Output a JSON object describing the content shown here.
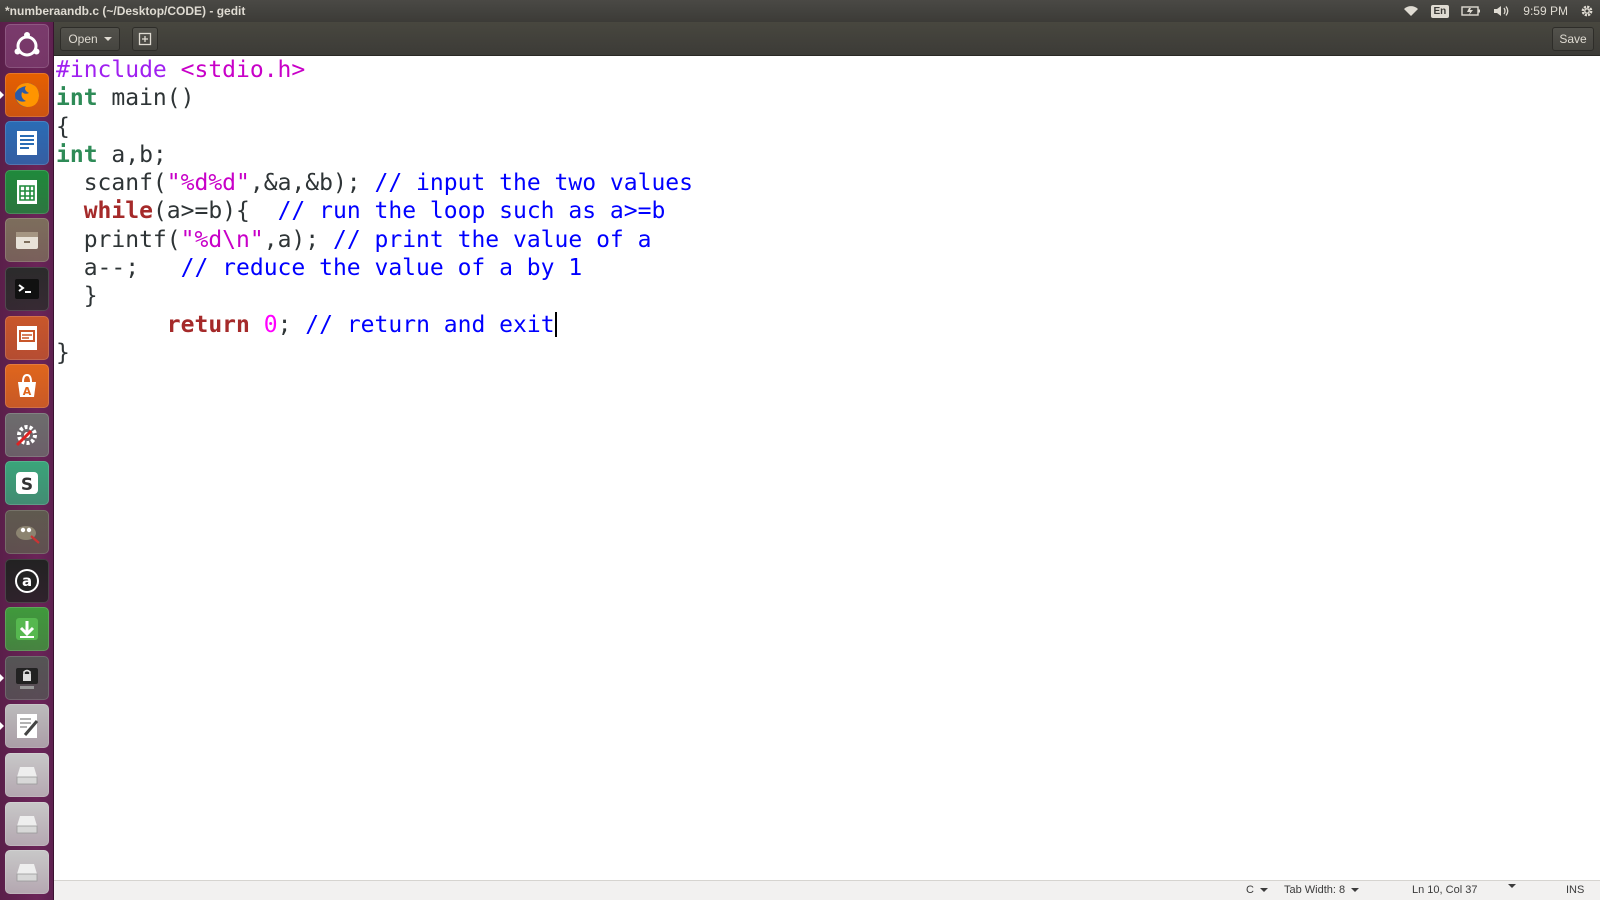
{
  "window": {
    "title": "*numberaandb.c (~/Desktop/CODE) - gedit"
  },
  "panel": {
    "keyboard_layout": "En",
    "clock": "9:59 PM",
    "icons": [
      "wifi-icon",
      "battery-icon",
      "volume-icon",
      "gear-icon"
    ]
  },
  "launcher": {
    "items": [
      {
        "name": "ubuntu-dash-icon",
        "color": "#7a3b6c"
      },
      {
        "name": "firefox-icon",
        "color": "#e66000"
      },
      {
        "name": "libreoffice-writer-icon",
        "color": "#2a6cb5"
      },
      {
        "name": "libreoffice-calc-icon",
        "color": "#1f8a3b"
      },
      {
        "name": "files-icon",
        "color": "#7d6e5c"
      },
      {
        "name": "terminal-icon",
        "color": "#2b2b2b"
      },
      {
        "name": "libreoffice-impress-icon",
        "color": "#c9572a"
      },
      {
        "name": "software-center-icon",
        "color": "#e0661c"
      },
      {
        "name": "system-settings-icon",
        "color": "#6d6d6d"
      },
      {
        "name": "slack-icon",
        "color": "#3aa57a"
      },
      {
        "name": "gimp-icon",
        "color": "#5f5a4f"
      },
      {
        "name": "amazon-icon",
        "color": "#222222"
      },
      {
        "name": "downloader-icon",
        "color": "#3f9a3c"
      },
      {
        "name": "screen-lock-icon",
        "color": "#555555"
      },
      {
        "name": "text-editor-icon",
        "color": "#bcbcbc"
      },
      {
        "name": "drive-icon",
        "color": "#c8c8c8"
      },
      {
        "name": "drive-icon-2",
        "color": "#c8c8c8"
      },
      {
        "name": "drive-icon-3",
        "color": "#c8c8c8"
      }
    ]
  },
  "toolbar": {
    "open_label": "Open",
    "save_label": "Save"
  },
  "editor": {
    "lines": [
      [
        {
          "t": "#include ",
          "c": "prep"
        },
        {
          "t": "<stdio.h>",
          "c": "prepval"
        }
      ],
      [
        {
          "t": "int",
          "c": "type"
        },
        {
          "t": " main()",
          "c": "plain"
        }
      ],
      [
        {
          "t": "{",
          "c": "plain"
        }
      ],
      [
        {
          "t": "int",
          "c": "type"
        },
        {
          "t": " a,b;",
          "c": "plain"
        }
      ],
      [
        {
          "t": "  scanf(",
          "c": "plain"
        },
        {
          "t": "\"%d%d\"",
          "c": "str"
        },
        {
          "t": ",&a,&b); ",
          "c": "plain"
        },
        {
          "t": "// input the two values",
          "c": "com"
        }
      ],
      [
        {
          "t": "  ",
          "c": "plain"
        },
        {
          "t": "while",
          "c": "kw"
        },
        {
          "t": "(a>=b){  ",
          "c": "plain"
        },
        {
          "t": "// run the loop such as a>=b",
          "c": "com"
        }
      ],
      [
        {
          "t": "  printf(",
          "c": "plain"
        },
        {
          "t": "\"%d\\n\"",
          "c": "str"
        },
        {
          "t": ",a); ",
          "c": "plain"
        },
        {
          "t": "// print the value of a",
          "c": "com"
        }
      ],
      [
        {
          "t": "  a--;   ",
          "c": "plain"
        },
        {
          "t": "// reduce the value of a by 1",
          "c": "com"
        }
      ],
      [
        {
          "t": "  }",
          "c": "plain"
        }
      ],
      [
        {
          "t": "        ",
          "c": "plain"
        },
        {
          "t": "return",
          "c": "kw"
        },
        {
          "t": " ",
          "c": "plain"
        },
        {
          "t": "0",
          "c": "num"
        },
        {
          "t": "; ",
          "c": "plain"
        },
        {
          "t": "// return and exit",
          "c": "com"
        }
      ],
      [
        {
          "t": "}",
          "c": "plain"
        }
      ]
    ],
    "cursor_line": 10,
    "cursor_col": 37
  },
  "statusbar": {
    "language": "C",
    "tab_width": "Tab Width: 8",
    "position": "Ln 10, Col 37",
    "mode": "INS"
  }
}
